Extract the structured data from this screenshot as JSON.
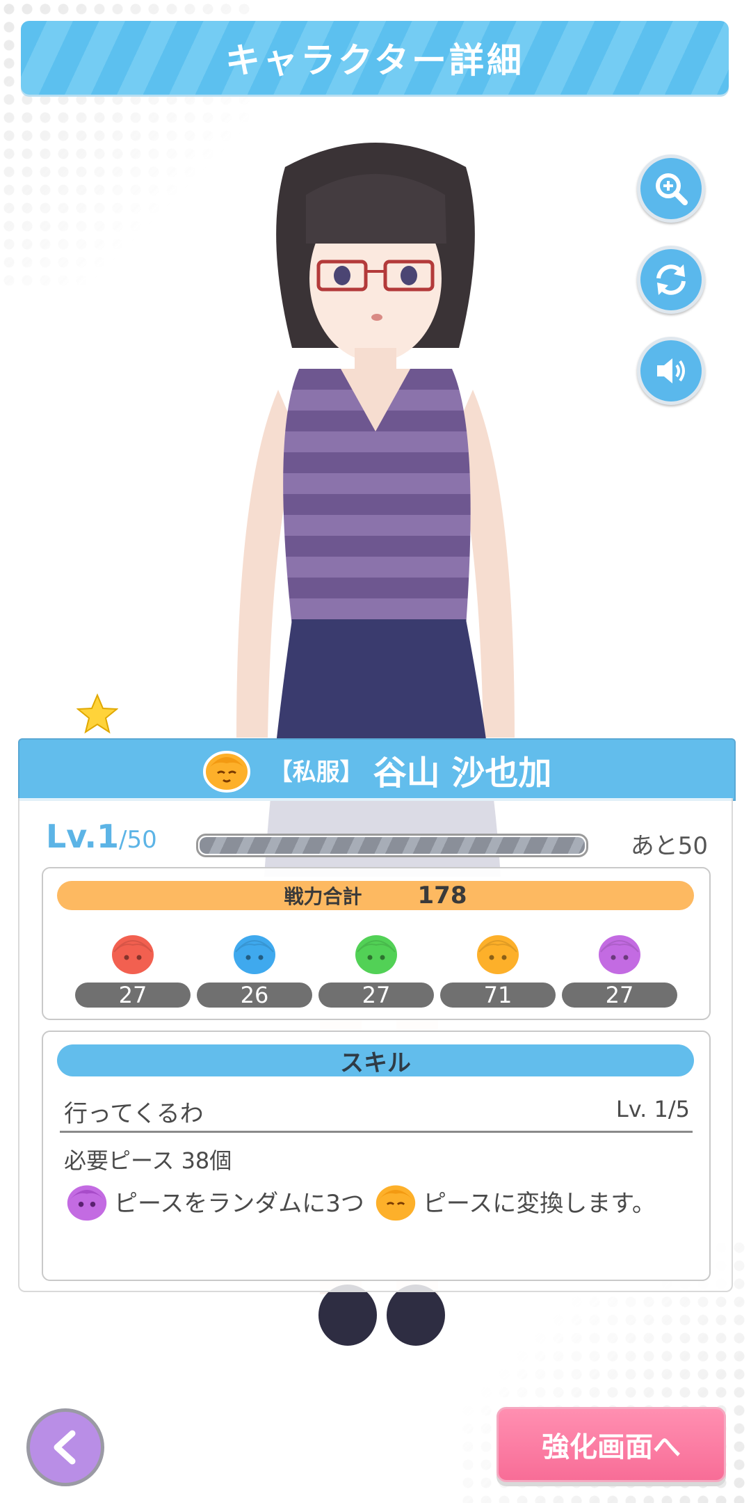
{
  "header": {
    "title": "キャラクター詳細"
  },
  "side_buttons": [
    {
      "icon": "zoom-in-icon"
    },
    {
      "icon": "rotate-icon"
    },
    {
      "icon": "speaker-icon"
    }
  ],
  "character": {
    "outfit_tag": "【私服】",
    "name": "谷山 沙也加",
    "rarity_stars": 1,
    "level_label": "Lv.",
    "level": "1",
    "max_level": "/50",
    "xp_progress": 0,
    "remaining": "あと50"
  },
  "stats": {
    "power_label": "戦力合計",
    "power_total": "178",
    "attributes": [
      {
        "color": "#f26050",
        "value": "27"
      },
      {
        "color": "#3fa9ee",
        "value": "26"
      },
      {
        "color": "#52d156",
        "value": "27"
      },
      {
        "color": "#fdb02a",
        "value": "71"
      },
      {
        "color": "#c36be2",
        "value": "27"
      }
    ]
  },
  "skill": {
    "header": "スキル",
    "name": "行ってくるわ",
    "level": "Lv. 1/5",
    "cost": "必要ピース 38個",
    "desc_part1": "ピースをランダムに3つ",
    "desc_part2": "ピースに変換します。"
  },
  "footer": {
    "back_icon": "chevron-left-icon",
    "enhance_label": "強化画面へ"
  },
  "colors": {
    "accent": "#62bdec",
    "power": "#fdb961",
    "enhance": "#f86d97",
    "back": "#b98ee6"
  }
}
